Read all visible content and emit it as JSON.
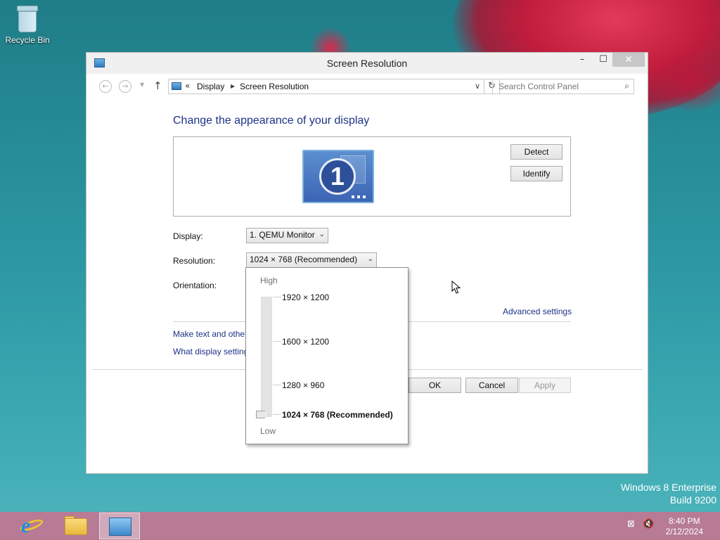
{
  "desktop": {
    "icons": [
      {
        "label": "Recycle Bin",
        "icon": "recycle-bin-icon"
      }
    ],
    "branding": {
      "line1": "Windows 8 Enterprise",
      "line2": "Build 9200"
    }
  },
  "window": {
    "title": "Screen Resolution",
    "controls": {
      "minimize": "–",
      "maximize": "☐",
      "close": "✕"
    },
    "address": {
      "sep": "«",
      "breadcrumbs": [
        "Display",
        "Screen Resolution"
      ],
      "search_placeholder": "Search Control Panel"
    },
    "heading": "Change the appearance of your display",
    "monitor_number": "1",
    "buttons": {
      "detect": "Detect",
      "identify": "Identify",
      "ok": "OK",
      "cancel": "Cancel",
      "apply": "Apply"
    },
    "fields": {
      "display_label": "Display:",
      "display_value": "1. QEMU Monitor",
      "resolution_label": "Resolution:",
      "resolution_value": "1024 × 768 (Recommended)",
      "orientation_label": "Orientation:"
    },
    "links": {
      "advanced": "Advanced settings",
      "make_text": "Make text and other items larger or smaller",
      "what_settings": "What display settings should I choose?"
    },
    "resolution_dropdown": {
      "high": "High",
      "low": "Low",
      "options": [
        "1920 × 1200",
        "1600 × 1200",
        "1280 × 960",
        "1024 × 768 (Recommended)"
      ],
      "selected_index": 3
    }
  },
  "taskbar": {
    "items": [
      "internet-explorer-icon",
      "file-explorer-icon",
      "control-panel-icon"
    ],
    "active_item": "control-panel-icon",
    "clock": {
      "time": "8:40 PM",
      "date": "2/12/2024"
    }
  }
}
